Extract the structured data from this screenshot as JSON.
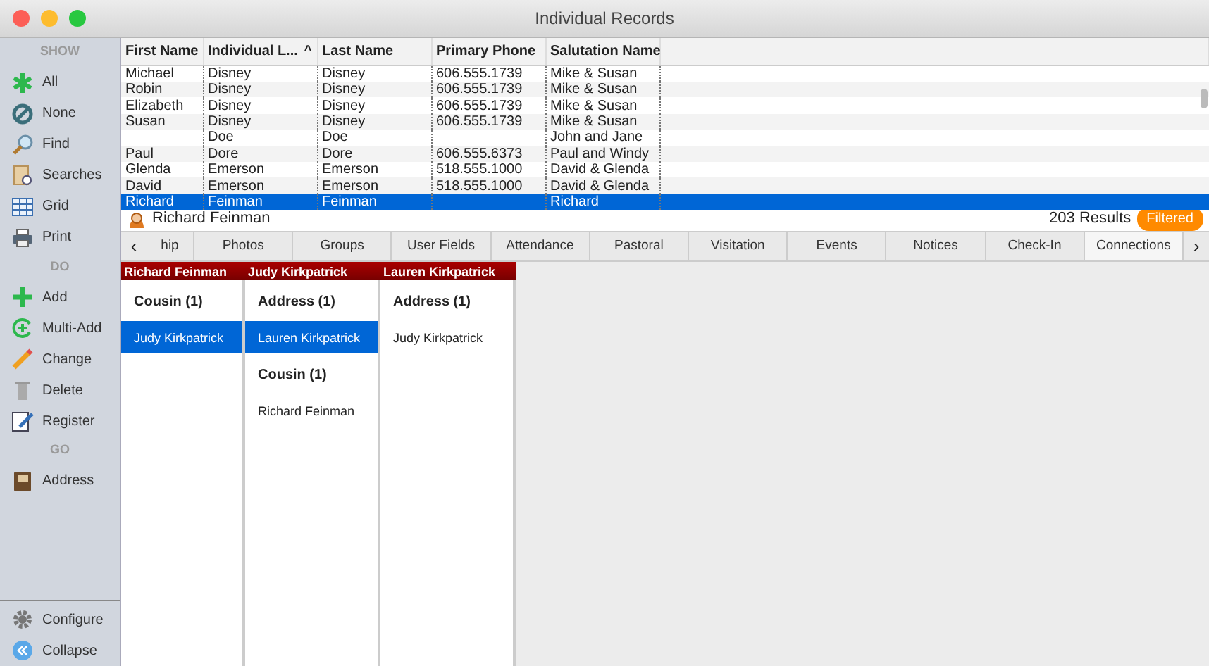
{
  "window": {
    "title": "Individual Records"
  },
  "sidebar": {
    "sections": [
      {
        "heading": "SHOW",
        "items": [
          {
            "label": "All"
          },
          {
            "label": "None"
          },
          {
            "label": "Find"
          },
          {
            "label": "Searches"
          },
          {
            "label": "Grid"
          },
          {
            "label": "Print"
          }
        ]
      },
      {
        "heading": "DO",
        "items": [
          {
            "label": "Add"
          },
          {
            "label": "Multi-Add"
          },
          {
            "label": "Change"
          },
          {
            "label": "Delete"
          },
          {
            "label": "Register"
          }
        ]
      },
      {
        "heading": "GO",
        "items": [
          {
            "label": "Address"
          }
        ]
      }
    ],
    "footer": [
      {
        "label": "Configure"
      },
      {
        "label": "Collapse"
      }
    ]
  },
  "table": {
    "columns": [
      {
        "label": "First Name"
      },
      {
        "label": "Individual L...",
        "sort_indicator": "^"
      },
      {
        "label": "Last Name"
      },
      {
        "label": "Primary Phone"
      },
      {
        "label": "Salutation Name"
      }
    ],
    "rows": [
      {
        "cells": [
          "Michael",
          "Disney",
          "Disney",
          "606.555.1739",
          "Mike & Susan"
        ],
        "selected": false
      },
      {
        "cells": [
          "Robin",
          "Disney",
          "Disney",
          "606.555.1739",
          "Mike & Susan"
        ],
        "selected": false
      },
      {
        "cells": [
          "Elizabeth",
          "Disney",
          "Disney",
          "606.555.1739",
          "Mike & Susan"
        ],
        "selected": false
      },
      {
        "cells": [
          "Susan",
          "Disney",
          "Disney",
          "606.555.1739",
          "Mike & Susan"
        ],
        "selected": false
      },
      {
        "cells": [
          "",
          "Doe",
          "Doe",
          "",
          "John and Jane"
        ],
        "selected": false
      },
      {
        "cells": [
          "Paul",
          "Dore",
          "Dore",
          "606.555.6373",
          "Paul and Windy"
        ],
        "selected": false
      },
      {
        "cells": [
          "Glenda",
          "Emerson",
          "Emerson",
          "518.555.1000",
          "David & Glenda"
        ],
        "selected": false
      },
      {
        "cells": [
          "David",
          "Emerson",
          "Emerson",
          "518.555.1000",
          "David & Glenda"
        ],
        "selected": false
      },
      {
        "cells": [
          "Richard",
          "Feinman",
          "Feinman",
          "",
          "Richard"
        ],
        "selected": true
      }
    ]
  },
  "record": {
    "name": "Richard Feinman",
    "results": "203 Results",
    "filter_badge": "Filtered"
  },
  "tabs": {
    "prev": "‹",
    "next": "›",
    "items": [
      {
        "label": "hip",
        "selected": false
      },
      {
        "label": "Photos",
        "selected": false
      },
      {
        "label": "Groups",
        "selected": false
      },
      {
        "label": "User Fields",
        "selected": false
      },
      {
        "label": "Attendance",
        "selected": false
      },
      {
        "label": "Pastoral",
        "selected": false
      },
      {
        "label": "Visitation",
        "selected": false
      },
      {
        "label": "Events",
        "selected": false
      },
      {
        "label": "Notices",
        "selected": false
      },
      {
        "label": "Check-In",
        "selected": false
      },
      {
        "label": "Connections",
        "selected": true
      }
    ]
  },
  "connections": [
    {
      "person": "Richard Feinman",
      "groups": [
        {
          "title": "Cousin (1)",
          "items": [
            {
              "label": "Judy Kirkpatrick",
              "selected": true
            }
          ]
        }
      ]
    },
    {
      "person": "Judy Kirkpatrick",
      "groups": [
        {
          "title": "Address (1)",
          "items": [
            {
              "label": "Lauren Kirkpatrick",
              "selected": true
            }
          ]
        },
        {
          "title": "Cousin (1)",
          "items": [
            {
              "label": "Richard Feinman",
              "selected": false
            }
          ]
        }
      ]
    },
    {
      "person": "Lauren Kirkpatrick",
      "groups": [
        {
          "title": "Address (1)",
          "items": [
            {
              "label": "Judy Kirkpatrick",
              "selected": false
            }
          ]
        }
      ]
    }
  ]
}
